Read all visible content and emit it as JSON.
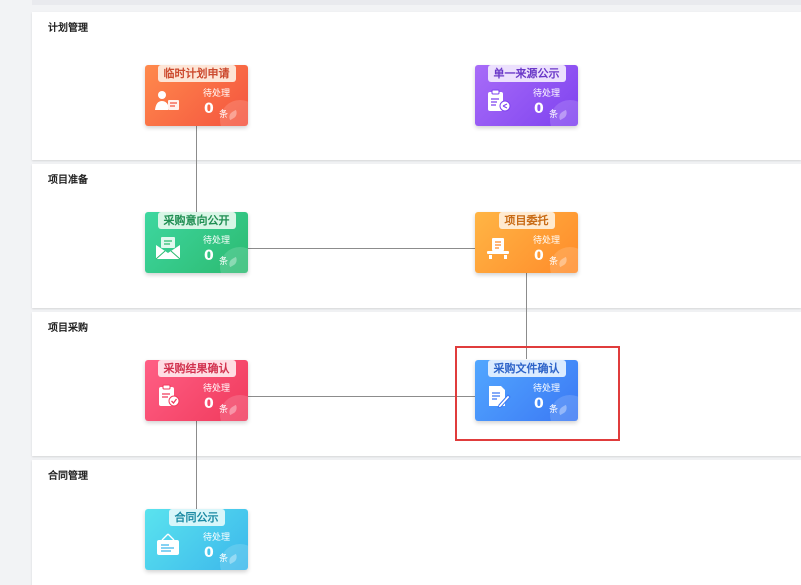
{
  "sections": [
    {
      "title": "计划管理"
    },
    {
      "title": "项目准备"
    },
    {
      "title": "项目采购"
    },
    {
      "title": "合同管理"
    }
  ],
  "cards": [
    {
      "label": "临时计划申请",
      "pending_label": "待处理",
      "count": "0",
      "unit": "条",
      "icon": "person-document-icon",
      "color": "#f4533f"
    },
    {
      "label": "单一来源公示",
      "pending_label": "待处理",
      "count": "0",
      "unit": "条",
      "icon": "clipboard-share-icon",
      "color": "#7e42ef"
    },
    {
      "label": "采购意向公开",
      "pending_label": "待处理",
      "count": "0",
      "unit": "条",
      "icon": "envelope-icon",
      "color": "#2cba70"
    },
    {
      "label": "项目委托",
      "pending_label": "待处理",
      "count": "0",
      "unit": "条",
      "icon": "register-desk-icon",
      "color": "#ff8b2a"
    },
    {
      "label": "采购结果确认",
      "pending_label": "待处理",
      "count": "0",
      "unit": "条",
      "icon": "clipboard-check-icon",
      "color": "#f03a5c"
    },
    {
      "label": "采购文件确认",
      "pending_label": "待处理",
      "count": "0",
      "unit": "条",
      "icon": "document-pen-icon",
      "color": "#3b78f4"
    },
    {
      "label": "合同公示",
      "pending_label": "待处理",
      "count": "0",
      "unit": "条",
      "icon": "notice-board-icon",
      "color": "#3cb7ec"
    }
  ],
  "highlight_color": "#e03c3c"
}
